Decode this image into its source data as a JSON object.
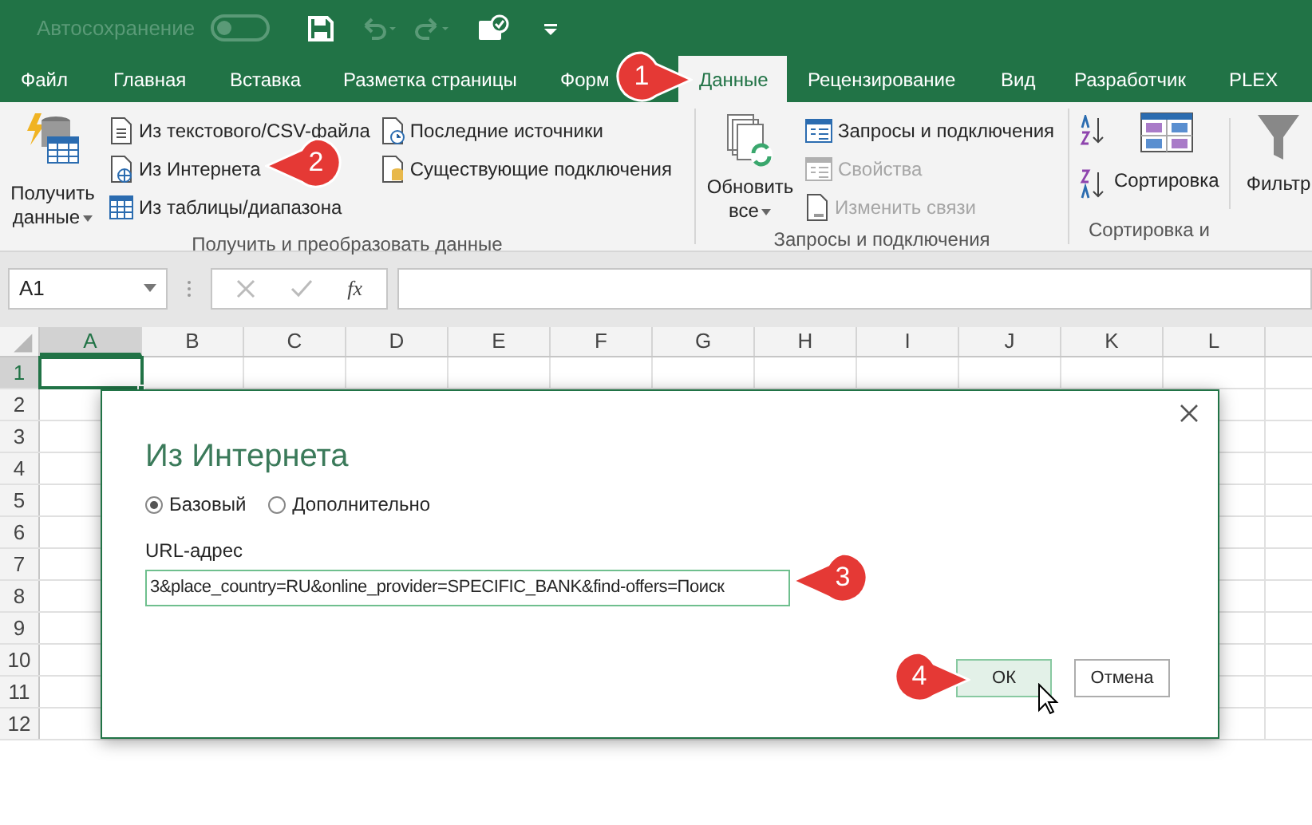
{
  "title_bar": {
    "autosave_label": "Автосохранение",
    "autosave_on": false
  },
  "tabs": [
    {
      "label": "Файл",
      "selected": false
    },
    {
      "label": "Главная",
      "selected": false
    },
    {
      "label": "Вставка",
      "selected": false
    },
    {
      "label": "Разметка страницы",
      "selected": false
    },
    {
      "label": "Форм",
      "selected": false
    },
    {
      "label": "Данные",
      "selected": true
    },
    {
      "label": "Рецензирование",
      "selected": false
    },
    {
      "label": "Вид",
      "selected": false
    },
    {
      "label": "Разработчик",
      "selected": false
    },
    {
      "label": "PLEX",
      "selected": false
    }
  ],
  "ribbon": {
    "get_data": {
      "big_button": [
        "Получить",
        "данные"
      ],
      "columns": [
        [
          {
            "label": "Из текстового/CSV-файла",
            "disabled": false
          },
          {
            "label": "Из Интернета",
            "disabled": false
          },
          {
            "label": "Из таблицы/диапазона",
            "disabled": false
          }
        ],
        [
          {
            "label": "Последние источники",
            "disabled": false
          },
          {
            "label": "Существующие подключения",
            "disabled": false
          }
        ]
      ],
      "label": "Получить и преобразовать данные"
    },
    "queries": {
      "big_button": [
        "Обновить",
        "все"
      ],
      "items": [
        {
          "label": "Запросы и подключения",
          "disabled": false
        },
        {
          "label": "Свойства",
          "disabled": true
        },
        {
          "label": "Изменить связи",
          "disabled": true
        }
      ],
      "label": "Запросы и подключения"
    },
    "sort": {
      "sort_button": "Сортировка",
      "filter_button": "Фильтр",
      "label": "Сортировка и"
    }
  },
  "formula_bar": {
    "name_box": "A1",
    "fx": "fx"
  },
  "sheet": {
    "columns": [
      {
        "label": "A",
        "selected": true
      },
      {
        "label": "B",
        "selected": false
      },
      {
        "label": "C",
        "selected": false
      },
      {
        "label": "D",
        "selected": false
      },
      {
        "label": "E",
        "selected": false
      },
      {
        "label": "F",
        "selected": false
      },
      {
        "label": "G",
        "selected": false
      },
      {
        "label": "H",
        "selected": false
      },
      {
        "label": "I",
        "selected": false
      },
      {
        "label": "J",
        "selected": false
      },
      {
        "label": "K",
        "selected": false
      },
      {
        "label": "L",
        "selected": false
      }
    ],
    "rows": [
      {
        "label": "1",
        "selected": true
      },
      {
        "label": "2",
        "selected": false
      },
      {
        "label": "3",
        "selected": false
      },
      {
        "label": "4",
        "selected": false
      },
      {
        "label": "5",
        "selected": false
      },
      {
        "label": "6",
        "selected": false
      },
      {
        "label": "7",
        "selected": false
      },
      {
        "label": "8",
        "selected": false
      },
      {
        "label": "9",
        "selected": false
      },
      {
        "label": "10",
        "selected": false
      },
      {
        "label": "11",
        "selected": false
      },
      {
        "label": "12",
        "selected": false
      }
    ]
  },
  "dialog": {
    "title": "Из Интернета",
    "modes": [
      {
        "label": "Базовый",
        "selected": true
      },
      {
        "label": "Дополнительно",
        "selected": false
      }
    ],
    "url_label": "URL-адрес",
    "url_value": "3&place_country=RU&online_provider=SPECIFIC_BANK&find-offers=Поиск",
    "buttons": [
      {
        "label": "ОК",
        "kind": "primary"
      },
      {
        "label": "Отмена",
        "kind": "secondary"
      }
    ]
  },
  "callouts": [
    "1",
    "2",
    "3",
    "4"
  ]
}
